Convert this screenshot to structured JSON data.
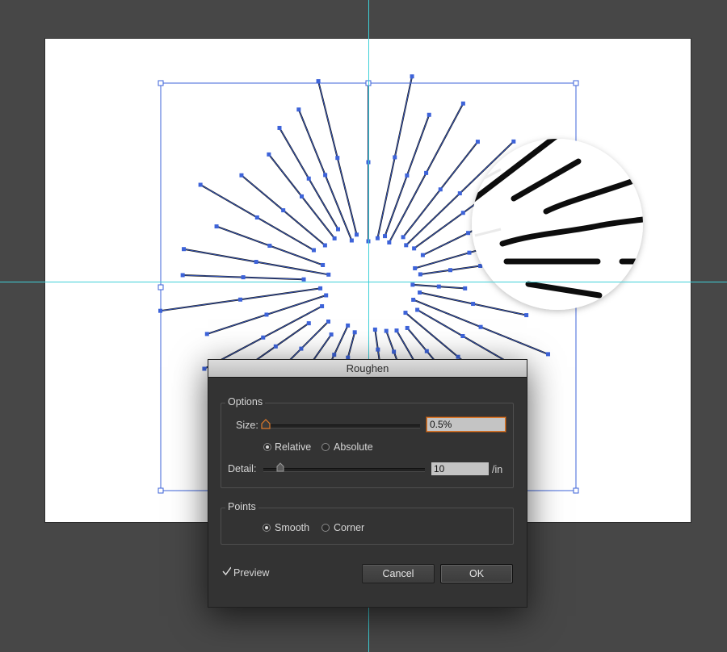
{
  "dialog": {
    "title": "Roughen",
    "options": {
      "group_label": "Options",
      "size_label": "Size:",
      "size_value": "0.5%",
      "size_level_percent": 0.5,
      "relative_label": "Relative",
      "absolute_label": "Absolute",
      "mode_selected": "Relative",
      "detail_label": "Detail:",
      "detail_value": "10",
      "detail_unit": "/in",
      "detail_level_percent": 10
    },
    "points": {
      "group_label": "Points",
      "smooth_label": "Smooth",
      "corner_label": "Corner",
      "selected": "Smooth"
    },
    "preview": {
      "label": "Preview",
      "checked": true
    },
    "cancel_label": "Cancel",
    "ok_label": "OK"
  },
  "colors": {
    "workspace": "#474747",
    "artboard": "#ffffff",
    "guide": "#3fd0d8",
    "selection": "#3d63d9",
    "stroke": "#111111",
    "size_field_border": "#e07a2a"
  },
  "icons": {
    "slider_thumb": "slider-thumb-icon",
    "checkmark": "checkmark-icon"
  }
}
